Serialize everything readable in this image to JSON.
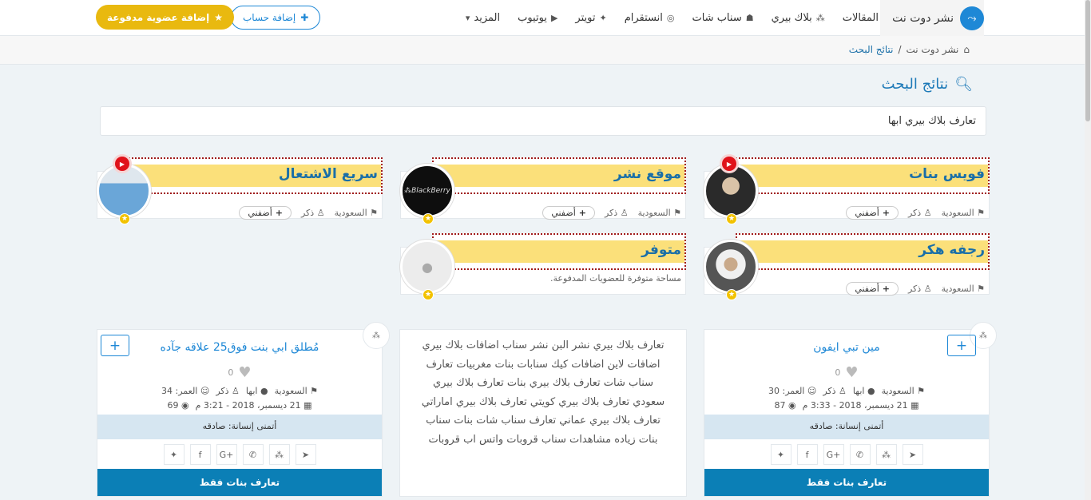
{
  "brand": {
    "name": "نشر دوت نت"
  },
  "nav": [
    {
      "label": "المقالات",
      "icon": ""
    },
    {
      "label": "بلاك بيري",
      "icon": "blackberry-icon"
    },
    {
      "label": "سناب شات",
      "icon": "snapchat-icon"
    },
    {
      "label": "انستقرام",
      "icon": "instagram-icon"
    },
    {
      "label": "تويتر",
      "icon": "twitter-icon"
    },
    {
      "label": "يوتيوب",
      "icon": "youtube-icon"
    },
    {
      "label": "المزيد",
      "icon": "caret-icon"
    }
  ],
  "header_buttons": {
    "add_account": "إضافة حساب",
    "add_paid": "إضافة عضوية مدفوعة"
  },
  "breadcrumb": {
    "home": "نشر دوت نت",
    "current": "نتائج البحث"
  },
  "page_title": "نتائج البحث",
  "search": {
    "value": "تعارف بلاك بيري ابها"
  },
  "featured": [
    {
      "name": "فويس بنات",
      "country": "السعودية",
      "gender": "ذكر",
      "follow": "أضفني",
      "has_voice": true
    },
    {
      "name": "موقع نشر",
      "country": "السعودية",
      "gender": "ذكر",
      "follow": "أضفني",
      "has_voice": false
    },
    {
      "name": "سريع الاشتعال",
      "country": "السعودية",
      "gender": "ذكر",
      "follow": "أضفني",
      "has_voice": true
    },
    {
      "name": "رجفه هكر",
      "country": "السعودية",
      "gender": "ذكر",
      "follow": "أضفني",
      "has_voice": false
    },
    {
      "name": "متوفر",
      "description": "مساحة متوفرة للعضويات المدفوعة."
    }
  ],
  "profiles": [
    {
      "name": "مين تبي ايفون",
      "likes": "0",
      "country": "السعودية",
      "city": "ابها",
      "gender": "ذكر",
      "age_label": "العمر: 30",
      "date": "21 ديسمبر، 2018 - 3:33 م",
      "views": "87",
      "wish": "أتمنى إنسانة: صادقه",
      "cta": "تعارف بنات فقط"
    },
    {
      "name": "مُطلق ابي بنت فوق25 علاقه جآده",
      "likes": "0",
      "country": "السعودية",
      "city": "ابها",
      "gender": "ذكر",
      "age_label": "العمر: 34",
      "date": "21 ديسمبر، 2018 - 3:21 م",
      "views": "69",
      "wish": "أتمنى إنسانة: صادقه",
      "cta": "تعارف بنات فقط"
    }
  ],
  "middle_text": "تعارف بلاك بيري  نشر البن نشر سناب اضافات بلاك بيري اضافات لاين اضافات كيك سنابات بنات مغربيات تعارف سناب شات  تعارف بلاك بيري بنات تعارف بلاك بيري سعودي  تعارف بلاك بيري كويتي  تعارف بلاك بيري اماراتي  تعارف بلاك بيري عماني تعارف سناب شات بنات سناب بنات  زياده مشاهدات سناب  قروبات واتس اب قروبات"
}
